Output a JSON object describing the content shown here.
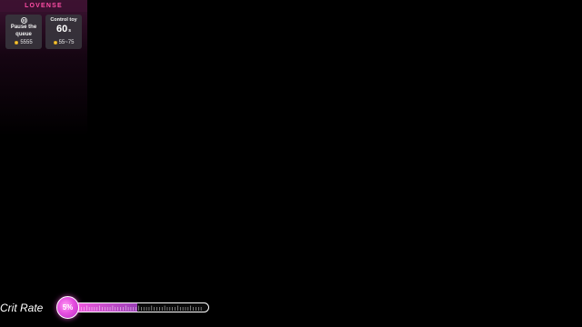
{
  "lovense": {
    "brand": "LOVENSE",
    "pause_card": {
      "label_line1": "Pause the",
      "label_line2": "queue",
      "tokens": "5555",
      "icon": "pause-icon"
    },
    "control_card": {
      "title": "Control toy",
      "value": "60",
      "unit": "s",
      "token_range": "55~75",
      "icon": "coin-icon"
    },
    "colors": {
      "brand_pink": "#ff4da6",
      "coin_gold": "#f3c23a"
    }
  },
  "crit_rate": {
    "label": "Crit Rate",
    "value_text": "5%",
    "fill_fraction": 0.5,
    "colors": {
      "fill_start": "#ff5fe6",
      "fill_end": "#9a3fb5"
    }
  }
}
